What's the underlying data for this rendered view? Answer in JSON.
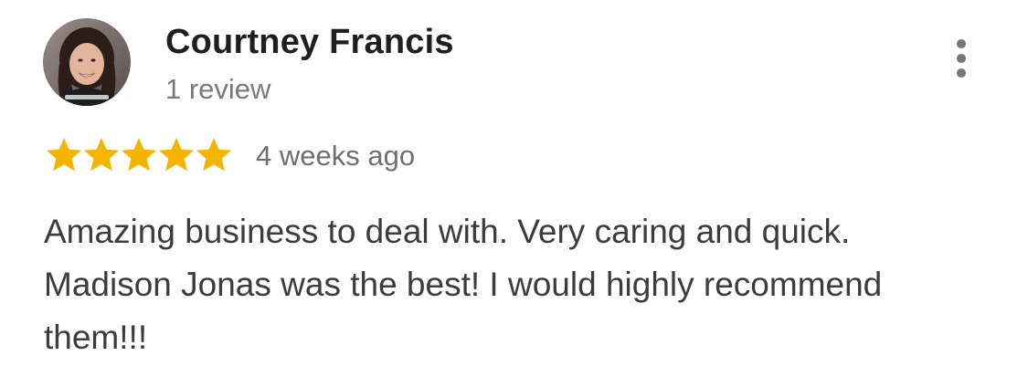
{
  "review": {
    "author_name": "Courtney Francis",
    "review_count": "1 review",
    "rating": 5,
    "rating_max": 5,
    "time_ago": "4 weeks ago",
    "text": "Amazing business to deal with. Very caring and quick. Madison Jonas was the best! I would highly recommend them!!!"
  },
  "icons": {
    "star": "star-icon",
    "more": "more-vert-icon",
    "avatar": "profile-photo"
  },
  "colors": {
    "star": "#F4B400",
    "name": "#1F1F1F",
    "secondary_text": "#757575",
    "body_text": "#3C3C3C",
    "more_icon": "#757575"
  }
}
